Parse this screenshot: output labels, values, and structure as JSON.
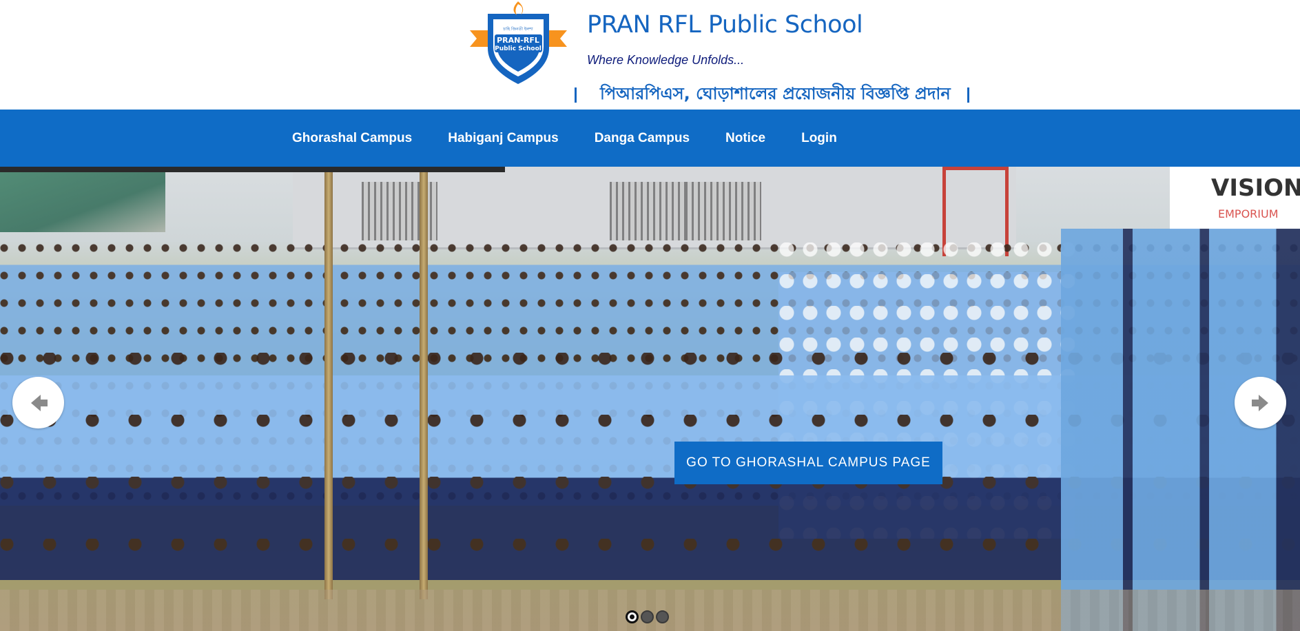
{
  "header": {
    "school_name": "PRAN RFL Public School",
    "tagline": "Where Knowledge Unfolds...",
    "notice": "পিআরপিএস, ঘোড়াশালের প্রয়োজনীয় বিজ্ঞপ্তি প্রদান",
    "logo": {
      "motto": "চাহি জিনতী ইলশা",
      "line1": "PRAN-RFL",
      "line2": "Public School",
      "colors": {
        "shield": "#1565c0",
        "ribbon": "#f7931e",
        "flame": "#f7931e"
      }
    }
  },
  "nav": {
    "items": [
      {
        "label": "Ghorashal Campus"
      },
      {
        "label": "Habiganj Campus"
      },
      {
        "label": "Danga Campus"
      },
      {
        "label": "Notice"
      },
      {
        "label": "Login"
      }
    ]
  },
  "slider": {
    "cta_label": "GO TO GHORASHAL CAMPUS PAGE",
    "prev_icon": "arrow-left-icon",
    "next_icon": "arrow-right-icon",
    "store_sign_line1": "VISION",
    "store_sign_line2": "EMPORIUM",
    "slide_count": 3,
    "active_slide": 1
  },
  "colors": {
    "brand_blue": "#0f6cc6",
    "title_blue": "#1565c0",
    "tagline_navy": "#0d1b7a"
  }
}
